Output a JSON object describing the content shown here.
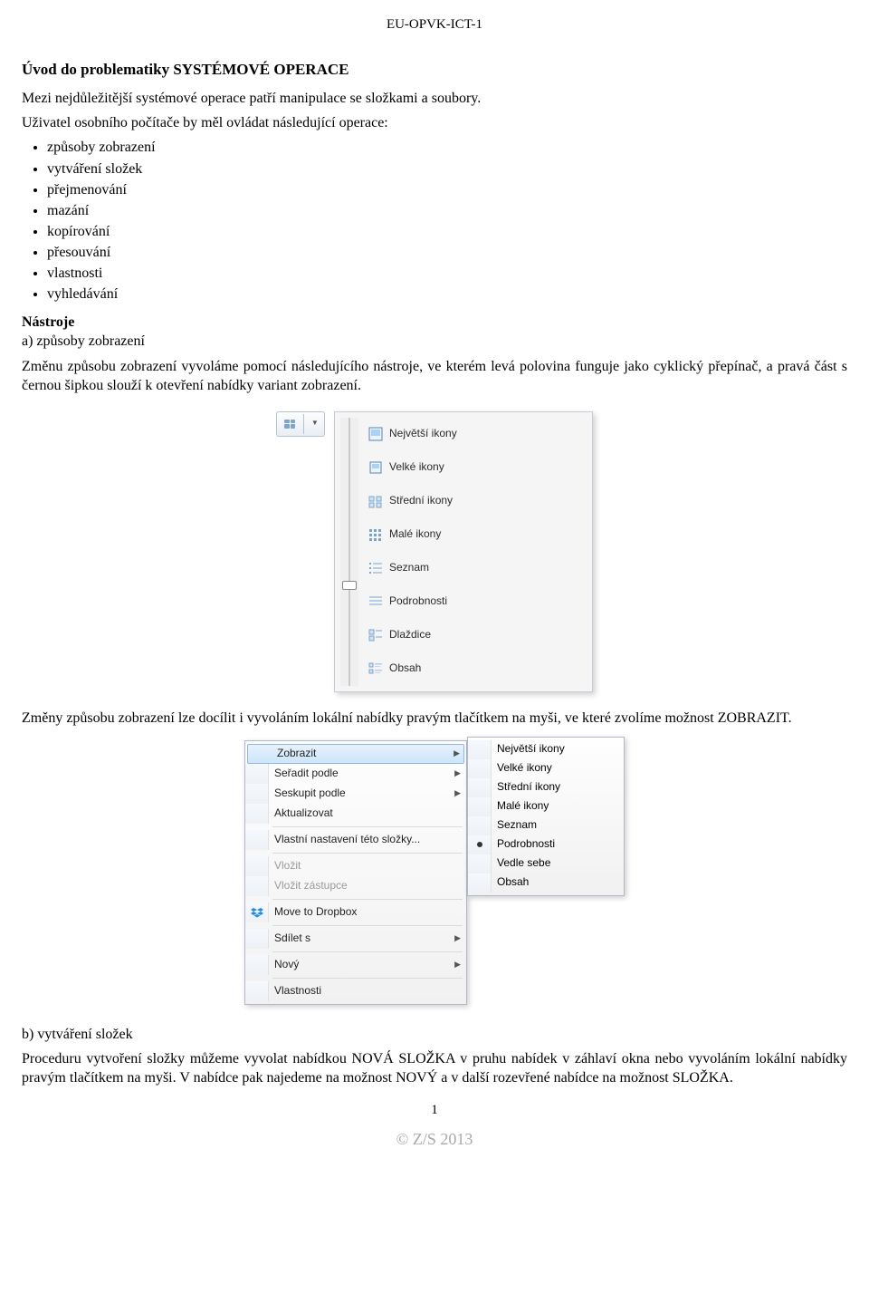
{
  "header_code": "EU-OPVK-ICT-1",
  "title": "Úvod do problematiky SYSTÉMOVÉ OPERACE",
  "intro1": "Mezi nejdůležitější systémové operace patří manipulace se složkami a soubory.",
  "intro2": "Uživatel osobního počítače by měl ovládat následující operace:",
  "bullets": [
    "způsoby zobrazení",
    "vytváření složek",
    "přejmenování",
    "mazání",
    "kopírování",
    "přesouvání",
    "vlastnosti",
    "vyhledávání"
  ],
  "tools_label": "Nástroje",
  "a_label": "a) způsoby zobrazení",
  "a_text": "Změnu způsobu zobrazení vyvoláme pomocí následujícího nástroje, ve kterém levá polovina funguje jako cyklický přepínač, a pravá část s černou šipkou slouží k otevření nabídky variant zobrazení.",
  "view_options": [
    {
      "name": "largest-icons",
      "label": "Největší ikony"
    },
    {
      "name": "large-icons",
      "label": "Velké ikony"
    },
    {
      "name": "medium-icons",
      "label": "Střední ikony"
    },
    {
      "name": "small-icons",
      "label": "Malé ikony"
    },
    {
      "name": "list",
      "label": "Seznam"
    },
    {
      "name": "details",
      "label": "Podrobnosti"
    },
    {
      "name": "tiles",
      "label": "Dlaždice"
    },
    {
      "name": "content",
      "label": "Obsah"
    }
  ],
  "mid_text": "Změny způsobu zobrazení lze docílit i vyvoláním lokální nabídky pravým tlačítkem na myši, ve které zvolíme možnost ZOBRAZIT.",
  "ctx": {
    "items": [
      {
        "name": "view",
        "label": "Zobrazit",
        "arrow": true,
        "highlight": true
      },
      {
        "name": "sort",
        "label": "Seřadit podle",
        "arrow": true
      },
      {
        "name": "group",
        "label": "Seskupit podle",
        "arrow": true
      },
      {
        "name": "refresh",
        "label": "Aktualizovat"
      },
      {
        "sep": true
      },
      {
        "name": "custom-folder",
        "label": "Vlastní nastavení této složky..."
      },
      {
        "sep": true
      },
      {
        "name": "paste",
        "label": "Vložit",
        "disabled": true
      },
      {
        "name": "paste-shortcut",
        "label": "Vložit zástupce",
        "disabled": true
      },
      {
        "sep": true
      },
      {
        "name": "dropbox",
        "label": "Move to Dropbox",
        "icon": "dropbox"
      },
      {
        "sep": true
      },
      {
        "name": "share",
        "label": "Sdílet s",
        "arrow": true
      },
      {
        "sep": true
      },
      {
        "name": "new",
        "label": "Nový",
        "arrow": true
      },
      {
        "sep": true
      },
      {
        "name": "properties",
        "label": "Vlastnosti"
      }
    ],
    "sub": [
      {
        "name": "largest-icons",
        "label": "Největší ikony"
      },
      {
        "name": "large-icons",
        "label": "Velké ikony"
      },
      {
        "name": "medium-icons",
        "label": "Střední ikony"
      },
      {
        "name": "small-icons",
        "label": "Malé ikony"
      },
      {
        "name": "list",
        "label": "Seznam"
      },
      {
        "name": "details",
        "label": "Podrobnosti",
        "selected": true
      },
      {
        "name": "side-by-side",
        "label": "Vedle sebe"
      },
      {
        "name": "content",
        "label": "Obsah"
      }
    ]
  },
  "b_label": "b) vytváření složek",
  "b_text": "Proceduru vytvoření složky můžeme vyvolat nabídkou NOVÁ SLOŽKA v pruhu nabídek v záhlaví okna nebo vyvoláním lokální nabídky pravým tlačítkem na myši. V nabídce pak najedeme na možnost NOVÝ a v další rozevřené nabídce na možnost SLOŽKA.",
  "page_number": "1",
  "footer": "© Z/S 2013"
}
